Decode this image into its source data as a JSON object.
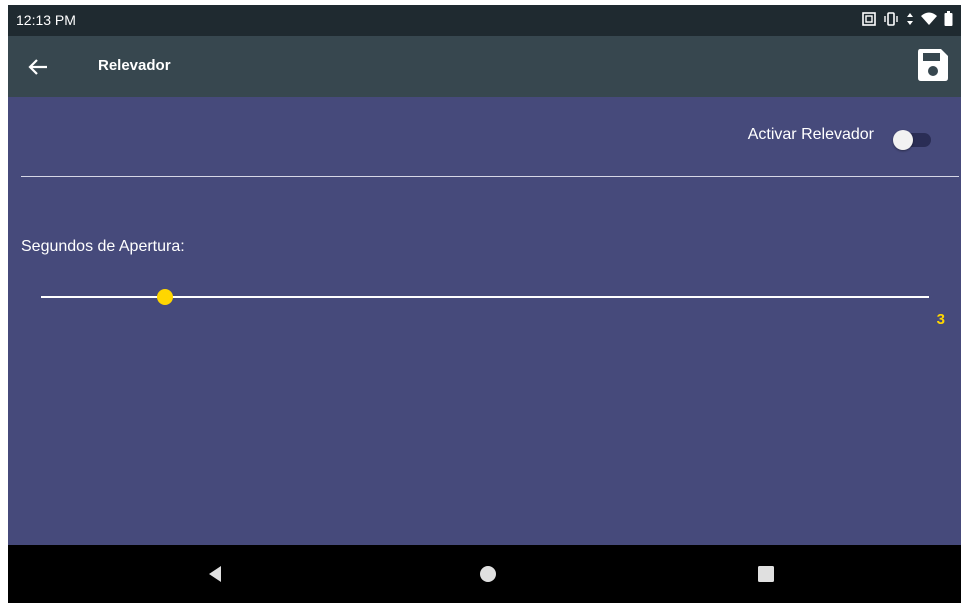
{
  "status_bar": {
    "time": "12:13 PM",
    "icons": [
      "screenshot-icon",
      "vibrate-icon",
      "data-arrows-icon",
      "wifi-icon",
      "battery-icon"
    ]
  },
  "app_bar": {
    "title": "Relevador",
    "back_icon": "arrow-left-icon",
    "save_icon": "floppy-disk-icon",
    "background": "#37474f"
  },
  "content": {
    "background": "#464a7b",
    "toggle": {
      "label": "Activar Relevador",
      "checked": false
    },
    "slider": {
      "label": "Segundos de Apertura:",
      "value": 3,
      "value_text": "3",
      "position_fraction": 0.14,
      "accent": "#ffd600"
    }
  },
  "nav_bar": {
    "buttons": [
      "back-triangle-icon",
      "home-circle-icon",
      "recents-square-icon"
    ]
  }
}
